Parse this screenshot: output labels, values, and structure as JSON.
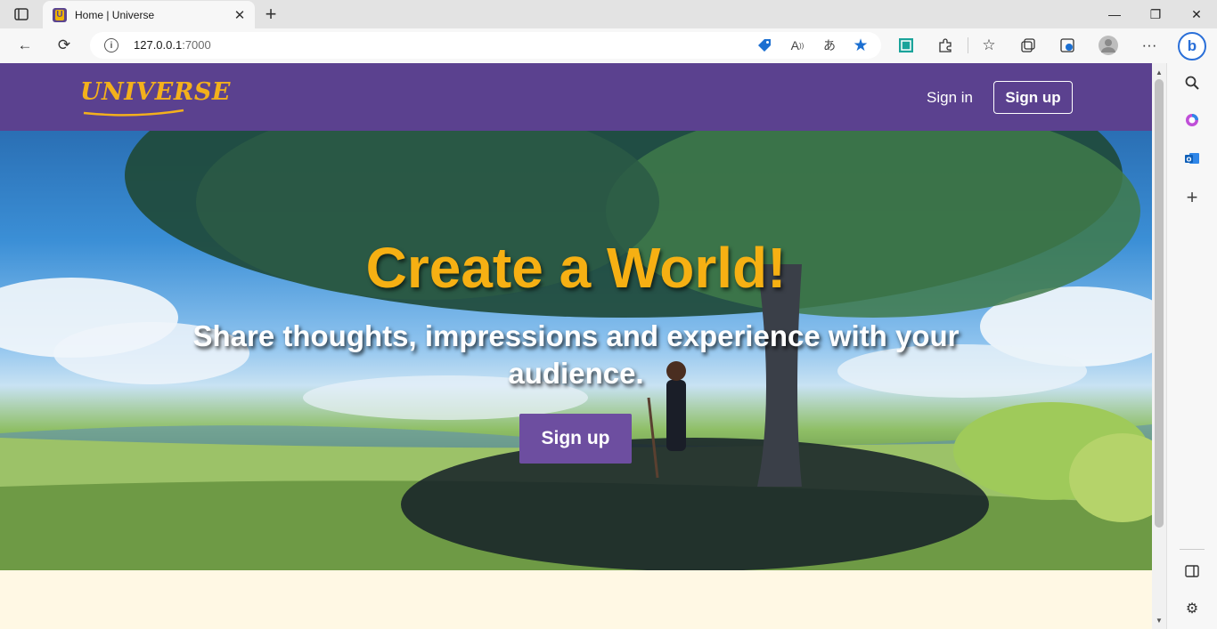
{
  "browser": {
    "tab_title": "Home | Universe",
    "tab_close": "✕",
    "new_tab": "+",
    "url_host": "127.0.0.1",
    "url_port": ":7000",
    "window_controls": {
      "minimize": "—",
      "maximize": "❐",
      "close": "✕"
    },
    "toolbar": {
      "back": "←",
      "reload": "⟳",
      "more": "···"
    },
    "bing": "b"
  },
  "navbar": {
    "logo": "UNIVERSE",
    "sign_in": "Sign in",
    "sign_up": "Sign up"
  },
  "hero": {
    "title": "Create a World!",
    "subtitle": "Share thoughts, impressions and experience with your audience.",
    "cta": "Sign up"
  },
  "colors": {
    "navbar": "#5b418f",
    "logo": "#f3b01c",
    "hero_title": "#f6b013",
    "cta": "#6d4ea0",
    "page_bg": "#fff8e4"
  }
}
